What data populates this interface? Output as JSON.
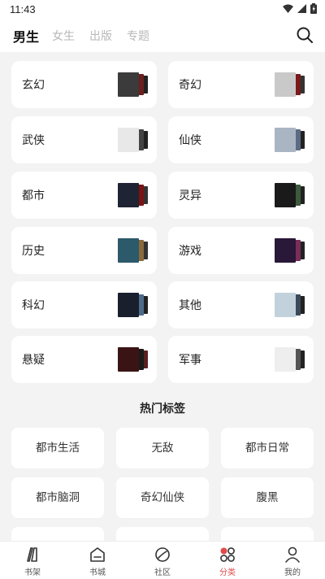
{
  "status": {
    "time": "11:43"
  },
  "tabs": [
    {
      "label": "男生",
      "active": true
    },
    {
      "label": "女生",
      "active": false
    },
    {
      "label": "出版",
      "active": false
    },
    {
      "label": "专题",
      "active": false
    }
  ],
  "categories": [
    {
      "label": "玄幻",
      "colors": [
        "#3b3b3b",
        "#6b1f1f",
        "#222"
      ]
    },
    {
      "label": "奇幻",
      "colors": [
        "#c9c9c9",
        "#7a1a1a",
        "#333"
      ]
    },
    {
      "label": "武侠",
      "colors": [
        "#e8e8e8",
        "#444",
        "#222"
      ]
    },
    {
      "label": "仙侠",
      "colors": [
        "#aab5c4",
        "#5b6b84",
        "#222"
      ]
    },
    {
      "label": "都市",
      "colors": [
        "#1e2433",
        "#7a1414",
        "#333"
      ]
    },
    {
      "label": "灵异",
      "colors": [
        "#1a1a1a",
        "#3c5a3c",
        "#222"
      ]
    },
    {
      "label": "历史",
      "colors": [
        "#2c5a6a",
        "#8a6a3a",
        "#333"
      ]
    },
    {
      "label": "游戏",
      "colors": [
        "#2a1838",
        "#7a2d5a",
        "#222"
      ]
    },
    {
      "label": "科幻",
      "colors": [
        "#1a1f2e",
        "#4d6b8a",
        "#222"
      ]
    },
    {
      "label": "其他",
      "colors": [
        "#c2d2dc",
        "#3a4a5a",
        "#222"
      ]
    },
    {
      "label": "悬疑",
      "colors": [
        "#3a1414",
        "#1a1a1a",
        "#5a1f1f"
      ]
    },
    {
      "label": "军事",
      "colors": [
        "#eeeeee",
        "#555",
        "#222"
      ]
    }
  ],
  "hot_tags": {
    "title": "热门标签",
    "items": [
      "都市生活",
      "无敌",
      "都市日常",
      "都市脑洞",
      "奇幻仙侠",
      "腹黑"
    ]
  },
  "bottom_nav": [
    {
      "label": "书架",
      "icon": "bookshelf-icon",
      "active": false
    },
    {
      "label": "书城",
      "icon": "bookstore-icon",
      "active": false
    },
    {
      "label": "社区",
      "icon": "community-icon",
      "active": false
    },
    {
      "label": "分类",
      "icon": "category-icon",
      "active": true
    },
    {
      "label": "我的",
      "icon": "profile-icon",
      "active": false
    }
  ],
  "accent_color": "#e24a4a"
}
